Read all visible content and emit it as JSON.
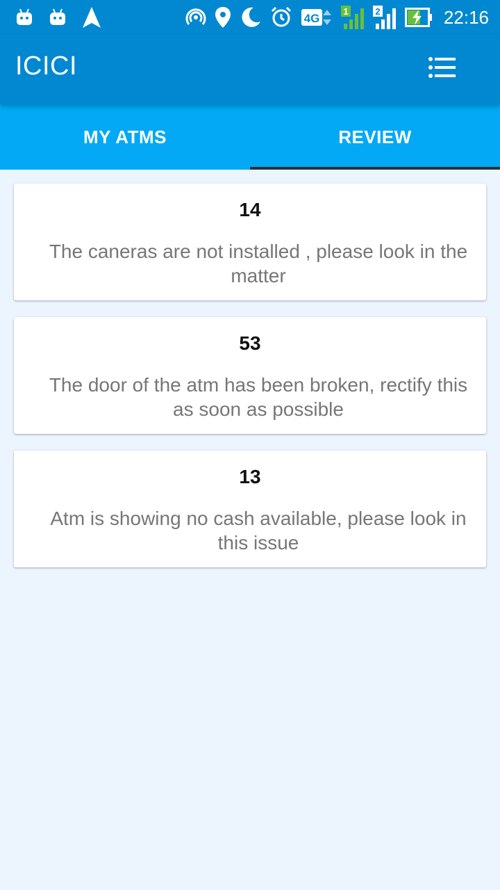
{
  "status_bar": {
    "time": "22:16",
    "network_label": "4G",
    "sim1_label": "1",
    "sim2_label": "2",
    "icons": [
      "android-icon",
      "android-icon",
      "navigation-icon",
      "hotspot-icon",
      "location-icon",
      "moon-icon",
      "alarm-icon",
      "network-4g-icon",
      "signal-sim1-icon",
      "signal-sim2-icon",
      "battery-charging-icon"
    ]
  },
  "app_bar": {
    "title": "ICICI",
    "menu_icon": "list-menu-icon"
  },
  "tabs": [
    {
      "label": "MY ATMS",
      "active": false
    },
    {
      "label": "REVIEW",
      "active": true
    }
  ],
  "reviews": [
    {
      "id": "14",
      "text": "The caneras are not installed , please look in the matter"
    },
    {
      "id": "53",
      "text": "The door of the atm has been broken, rectify this as soon as possible"
    },
    {
      "id": "13",
      "text": "Atm is showing no cash available, please look in this issue"
    }
  ],
  "colors": {
    "app_bar": "#0288d1",
    "tab_bar": "#03a9f4",
    "tab_indicator": "#263238",
    "background": "#ecf4fe",
    "card_text": "#767676"
  }
}
